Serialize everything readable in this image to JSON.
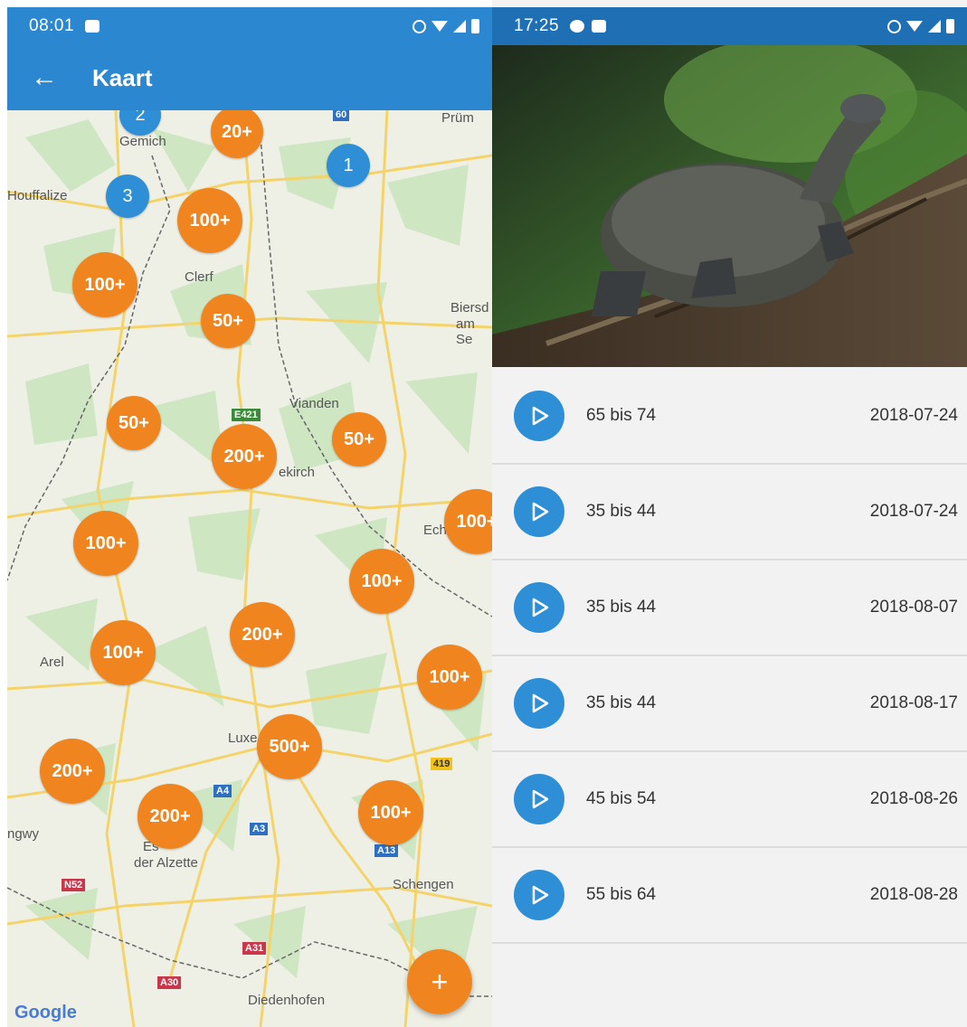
{
  "left": {
    "status": {
      "time": "08:01"
    },
    "toolbar": {
      "back_icon": "arrow-left-icon",
      "title": "Kaart"
    },
    "clusters": [
      {
        "label": "2",
        "color": "blue"
      },
      {
        "label": "20+",
        "color": "orange"
      },
      {
        "label": "1",
        "color": "blue"
      },
      {
        "label": "3",
        "color": "blue"
      },
      {
        "label": "100+",
        "color": "orange"
      },
      {
        "label": "100+",
        "color": "orange"
      },
      {
        "label": "50+",
        "color": "orange"
      },
      {
        "label": "50+",
        "color": "orange"
      },
      {
        "label": "200+",
        "color": "orange"
      },
      {
        "label": "50+",
        "color": "orange"
      },
      {
        "label": "100+",
        "color": "orange"
      },
      {
        "label": "100+",
        "color": "orange"
      },
      {
        "label": "100+",
        "color": "orange"
      },
      {
        "label": "200+",
        "color": "orange"
      },
      {
        "label": "100+",
        "color": "orange"
      },
      {
        "label": "100+",
        "color": "orange"
      },
      {
        "label": "500+",
        "color": "orange"
      },
      {
        "label": "200+",
        "color": "orange"
      },
      {
        "label": "200+",
        "color": "orange"
      },
      {
        "label": "100+",
        "color": "orange"
      }
    ],
    "places": [
      "Gemich",
      "Prüm",
      "Houffalize",
      "Clerf",
      "Biersd",
      "am Se",
      "Vianden",
      "ekirch",
      "Ech",
      "Arel",
      "Luxe",
      "ngwy",
      "Es",
      "der Alzette",
      "Schengen",
      "Diedenhofen"
    ],
    "shields": [
      "60",
      "E421",
      "A4",
      "A3",
      "A13",
      "419",
      "N52",
      "A31",
      "A30"
    ],
    "google": "Google",
    "fab": "+",
    "colors": {
      "orange": "#f0851f",
      "blue": "#2f8fd6",
      "appbar": "#2a87d0"
    }
  },
  "right": {
    "status": {
      "time": "17:25"
    },
    "recordings": [
      {
        "age": "65 bis 74",
        "date": "2018-07-24"
      },
      {
        "age": "35 bis 44",
        "date": "2018-07-24"
      },
      {
        "age": "35 bis 44",
        "date": "2018-08-07"
      },
      {
        "age": "35 bis 44",
        "date": "2018-08-17"
      },
      {
        "age": "45 bis 54",
        "date": "2018-08-26"
      },
      {
        "age": "55 bis 64",
        "date": "2018-08-28"
      }
    ]
  }
}
